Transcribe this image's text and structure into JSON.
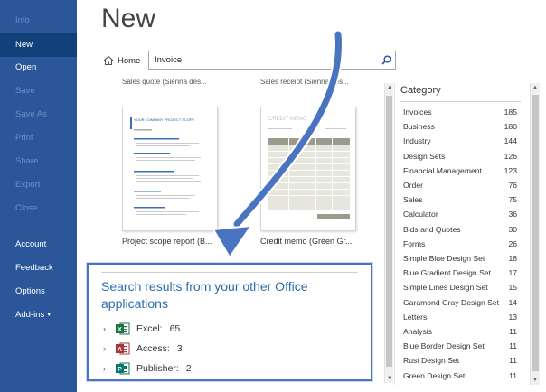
{
  "nav": {
    "items": [
      {
        "label": "Info",
        "state": "disabled"
      },
      {
        "label": "New",
        "state": "active"
      },
      {
        "label": "Open",
        "state": "normal"
      },
      {
        "label": "Save",
        "state": "disabled"
      },
      {
        "label": "Save As",
        "state": "disabled"
      },
      {
        "label": "Print",
        "state": "disabled"
      },
      {
        "label": "Share",
        "state": "disabled"
      },
      {
        "label": "Export",
        "state": "disabled"
      },
      {
        "label": "Close",
        "state": "disabled"
      },
      {
        "label": "Account",
        "state": "normal"
      },
      {
        "label": "Feedback",
        "state": "normal"
      },
      {
        "label": "Options",
        "state": "normal"
      },
      {
        "label": "Add-ins",
        "state": "normal"
      }
    ],
    "colors": {
      "bg": "#2b579a",
      "active": "#124078",
      "disabled_text": "#6d8fc4"
    }
  },
  "page_title": "New",
  "home_label": "Home",
  "search": {
    "value": "Invoice",
    "icon": "search-icon"
  },
  "cut_captions": [
    "Sales quote (Sienna des...",
    "Sales receipt (Sienna des..."
  ],
  "templates": [
    {
      "caption": "Project scope report (B...",
      "thumb_heading": "YOUR COMPANY PROJECT SCOPE"
    },
    {
      "caption": "Credit memo (Green Gr...",
      "thumb_heading": "CREDIT MEMO"
    }
  ],
  "results": {
    "title": "Search results from your other Office applications",
    "apps": [
      {
        "name": "Excel:",
        "count": "65",
        "icon": "excel-icon",
        "color": "#1e7145"
      },
      {
        "name": "Access:",
        "count": "3",
        "icon": "access-icon",
        "color": "#a4373a"
      },
      {
        "name": "Publisher:",
        "count": "2",
        "icon": "publisher-icon",
        "color": "#077568"
      }
    ],
    "border_color": "#4a73c0"
  },
  "category": {
    "header": "Category",
    "items": [
      {
        "label": "Invoices",
        "count": "185"
      },
      {
        "label": "Business",
        "count": "180"
      },
      {
        "label": "Industry",
        "count": "144"
      },
      {
        "label": "Design Sets",
        "count": "126"
      },
      {
        "label": "Financial Management",
        "count": "123"
      },
      {
        "label": "Order",
        "count": "76"
      },
      {
        "label": "Sales",
        "count": "75"
      },
      {
        "label": "Calculator",
        "count": "36"
      },
      {
        "label": "Bids and Quotes",
        "count": "30"
      },
      {
        "label": "Forms",
        "count": "26"
      },
      {
        "label": "Simple Blue Design Set",
        "count": "18"
      },
      {
        "label": "Blue Gradient Design Set",
        "count": "17"
      },
      {
        "label": "Simple Lines Design Set",
        "count": "15"
      },
      {
        "label": "Garamond Gray Design Set",
        "count": "14"
      },
      {
        "label": "Letters",
        "count": "13"
      },
      {
        "label": "Analysis",
        "count": "11"
      },
      {
        "label": "Blue Border Design Set",
        "count": "11"
      },
      {
        "label": "Rust Design Set",
        "count": "11"
      },
      {
        "label": "Green Design Set",
        "count": "11"
      }
    ]
  }
}
